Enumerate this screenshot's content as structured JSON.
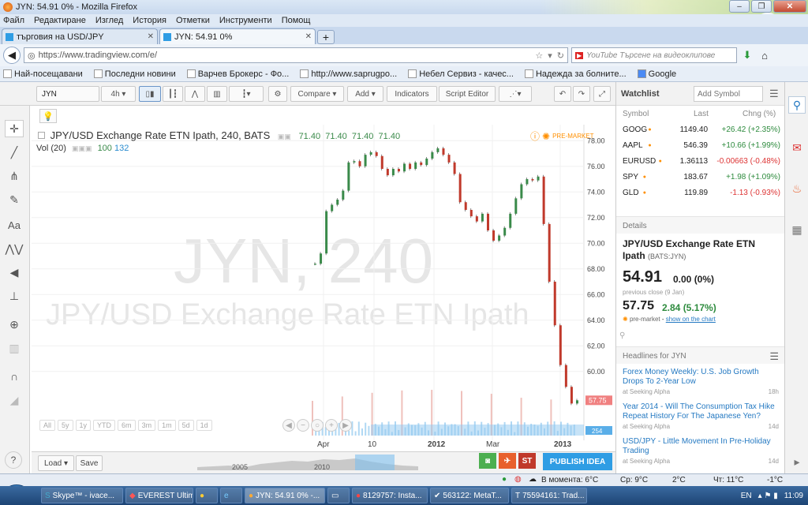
{
  "window": {
    "title": "JYN: 54.91 0% - Mozilla Firefox"
  },
  "menu": [
    "Файл",
    "Редактиране",
    "Изглед",
    "История",
    "Отметки",
    "Инструменти",
    "Помощ"
  ],
  "tabs": [
    {
      "label": "търговия на USD/JPY"
    },
    {
      "label": "JYN: 54.91 0%"
    }
  ],
  "url": "https://www.tradingview.com/e/",
  "search": {
    "placeholder": "YouTube Търсене на видеоклипове"
  },
  "bookmarks": [
    "Най-посещавани",
    "Последни новини",
    "Варчев Брокерс - Фо...",
    "http://www.saprugpo...",
    "Небел Сервиз - качес...",
    "Надежда за болните...",
    "Google"
  ],
  "toolbar": {
    "symbol": "JYN",
    "interval": "4h",
    "compare": "Compare",
    "add": "Add",
    "indicators": "Indicators",
    "script_editor": "Script Editor"
  },
  "chart_header": {
    "title": "JPY/USD Exchange Rate ETN Ipath, 240, BATS",
    "ohlc": [
      "71.40",
      "71.40",
      "71.40",
      "71.40"
    ],
    "vol_label": "Vol (20)",
    "vol_vals": [
      "100",
      "132"
    ],
    "premarket": "PRE-MARKET"
  },
  "watermark": {
    "symbol": "JYN, 240",
    "desc": "JPY/USD Exchange Rate ETN Ipath"
  },
  "chart_data": {
    "type": "candlestick",
    "x_ticks": [
      "Apr",
      "10",
      "2012",
      "Mar",
      "2013"
    ],
    "y_ticks": [
      78,
      76,
      74,
      72,
      70,
      68,
      66,
      64,
      62,
      60
    ],
    "ylim": [
      55,
      79
    ],
    "last_label": "57.75",
    "volume_label": "254",
    "points": [
      68.4,
      69.2,
      72.5,
      73.0,
      73.4,
      74.1,
      76.3,
      76.4,
      76.0,
      76.9,
      77.1,
      76.8,
      75.8,
      75.3,
      75.8,
      75.6,
      76.2,
      75.8,
      76.3,
      76.1,
      76.6,
      77.1,
      77.4,
      76.9,
      76.3,
      75.4,
      73.2,
      72.6,
      72.1,
      71.7,
      72.3,
      71.0,
      70.2,
      70.6,
      71.2,
      72.3,
      73.5,
      74.6,
      75.0,
      74.9,
      75.2,
      71.5,
      67.0,
      63.6,
      60.5,
      58.8,
      57.5,
      57.75
    ]
  },
  "ranges": [
    "All",
    "5y",
    "1y",
    "YTD",
    "6m",
    "3m",
    "1m",
    "5d",
    "1d"
  ],
  "minimap_years": [
    "2005",
    "2010"
  ],
  "bottom": {
    "load": "Load",
    "save": "Save",
    "publish": "PUBLISH IDEA",
    "share_st": "ST"
  },
  "watchlist": {
    "title": "Watchlist",
    "add_placeholder": "Add Symbol",
    "cols": [
      "Symbol",
      "Last",
      "Chng (%)"
    ],
    "rows": [
      {
        "sym": "GOOG",
        "last": "1149.40",
        "chg": "+26.42 (+2.35%)",
        "dir": "pos"
      },
      {
        "sym": "AAPL",
        "last": "546.39",
        "chg": "+10.66 (+1.99%)",
        "dir": "pos"
      },
      {
        "sym": "EURUSD",
        "last": "1.36113",
        "chg": "-0.00663 (-0.48%)",
        "dir": "neg"
      },
      {
        "sym": "SPY",
        "last": "183.67",
        "chg": "+1.98 (+1.09%)",
        "dir": "pos"
      },
      {
        "sym": "GLD",
        "last": "119.89",
        "chg": "-1.13 (-0.93%)",
        "dir": "neg"
      }
    ]
  },
  "details": {
    "head": "Details",
    "name": "JPY/USD Exchange Rate ETN Ipath",
    "exch": "(BATS:JYN)",
    "price": "54.91",
    "change": "0.00 (0%)",
    "prev": "previous close (9 Jan)",
    "pre_price": "57.75",
    "pre_change": "2.84 (5.17%)",
    "pre_label": "pre-market",
    "pre_link": "show on the chart"
  },
  "headlines": {
    "head": "Headlines for JYN",
    "items": [
      {
        "title": "Forex Money Weekly: U.S. Job Growth Drops To 2-Year Low",
        "source": "at Seeking Alpha",
        "time": "18h"
      },
      {
        "title": "Year 2014 - Will The Consumption Tax Hike Repeat History For The Japanese Yen?",
        "source": "at Seeking Alpha",
        "time": "14d"
      },
      {
        "title": "USD/JPY - Little Movement In Pre-Holiday Trading",
        "source": "at Seeking Alpha",
        "time": "14d"
      }
    ]
  },
  "statusbar": {
    "weather_now": "В момента: 6°C",
    "sr": "Ср: 9°C",
    "th": "Чт: 11°C",
    "d1": "2°C",
    "d2": "-1°C"
  },
  "taskbar": {
    "items": [
      "Skype™ - ivace...",
      "EVEREST Ultim...",
      "JYN: 54.91 0% -...",
      "8129757: Insta...",
      "563122: MetaT...",
      "75594161: Trad..."
    ],
    "lang": "EN",
    "clock": "11:09"
  },
  "colors": {
    "up": "#3a8a4a",
    "down": "#c0392b",
    "accent": "#2f9de4",
    "volume": "#8fc8ef"
  }
}
